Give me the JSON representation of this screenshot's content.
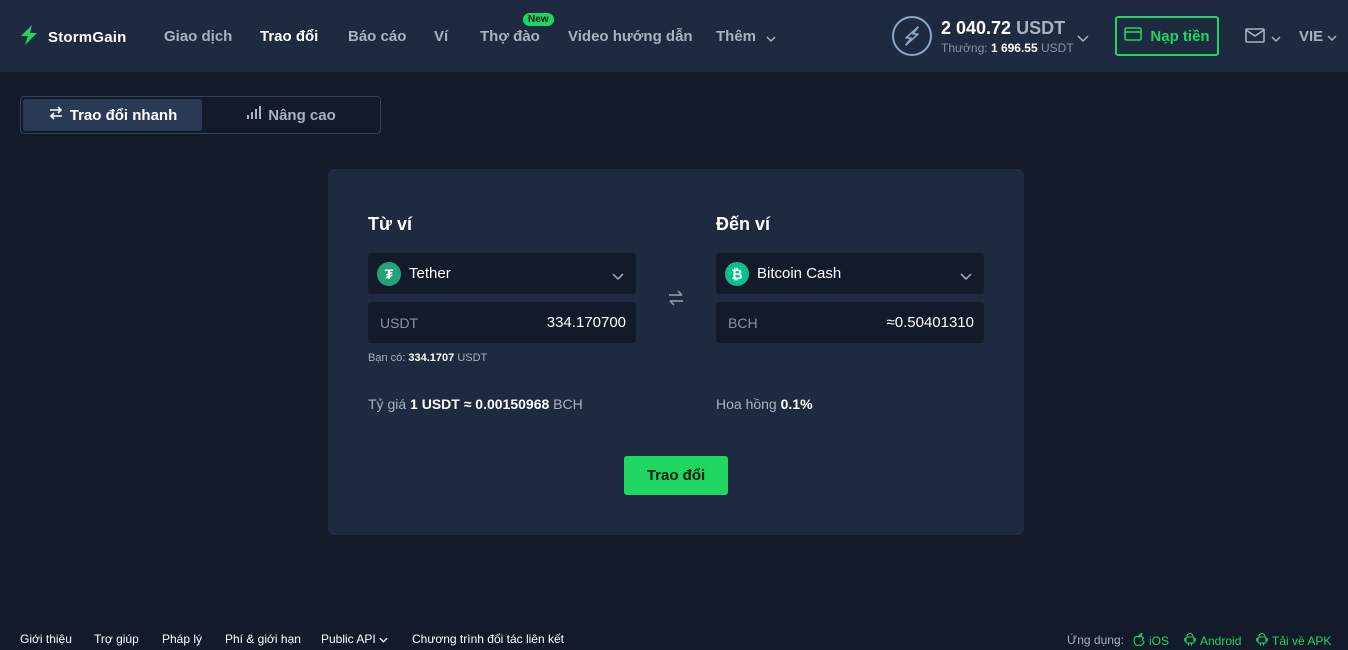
{
  "brand": {
    "name": "StormGain"
  },
  "nav": {
    "items": [
      "Giao dịch",
      "Trao đổi",
      "Báo cáo",
      "Ví",
      "Thợ đào",
      "Video hướng dẫn",
      "Thêm"
    ],
    "new_badge": "New"
  },
  "account": {
    "balance": "2 040.72",
    "balance_currency": "USDT",
    "bonus_label": "Thưởng:",
    "bonus_value": "1 696.55",
    "bonus_currency": "USDT"
  },
  "header": {
    "deposit_label": "Nạp tiền",
    "language": "VIE"
  },
  "mode_tabs": {
    "quick": "Trao đổi nhanh",
    "advanced": "Nâng cao"
  },
  "exchange": {
    "from": {
      "title": "Từ ví",
      "coin": "Tether",
      "coin_symbol": "₮",
      "currency": "USDT",
      "amount": "334.170700",
      "available_label": "Bạn có:",
      "available_value": "334.1707",
      "available_currency": "USDT"
    },
    "to": {
      "title": "Đến ví",
      "coin": "Bitcoin Cash",
      "coin_symbol": "₿",
      "currency": "BCH",
      "amount": "≈0.50401310"
    },
    "rate": {
      "label": "Tỷ giá",
      "from_amount": "1",
      "from_currency": "USDT",
      "approx": "≈",
      "to_amount": "0.00150968",
      "to_currency": "BCH"
    },
    "commission": {
      "label": "Hoa hồng",
      "value": "0.1%"
    },
    "submit_label": "Trao đổi"
  },
  "footer": {
    "links": [
      "Giới thiệu",
      "Trợ giúp",
      "Pháp lý",
      "Phí & giới hạn",
      "Public API",
      "Chương trình đối tác liên kết"
    ],
    "apps_label": "Ứng dụng:",
    "apps": [
      "iOS",
      "Android",
      "Tải về APK"
    ]
  },
  "colors": {
    "accent": "#1dd760",
    "tether": "#26a17b",
    "bch": "#0ac18e",
    "header_bg": "#1d2a40",
    "page_bg": "#131a2a"
  },
  "icons": [
    "bolt-logo-icon",
    "chevron-down-icon",
    "lightning-circle-icon",
    "card-icon",
    "mail-icon",
    "swap-arrows-icon",
    "bar-chart-icon",
    "apple-icon",
    "android-icon"
  ]
}
